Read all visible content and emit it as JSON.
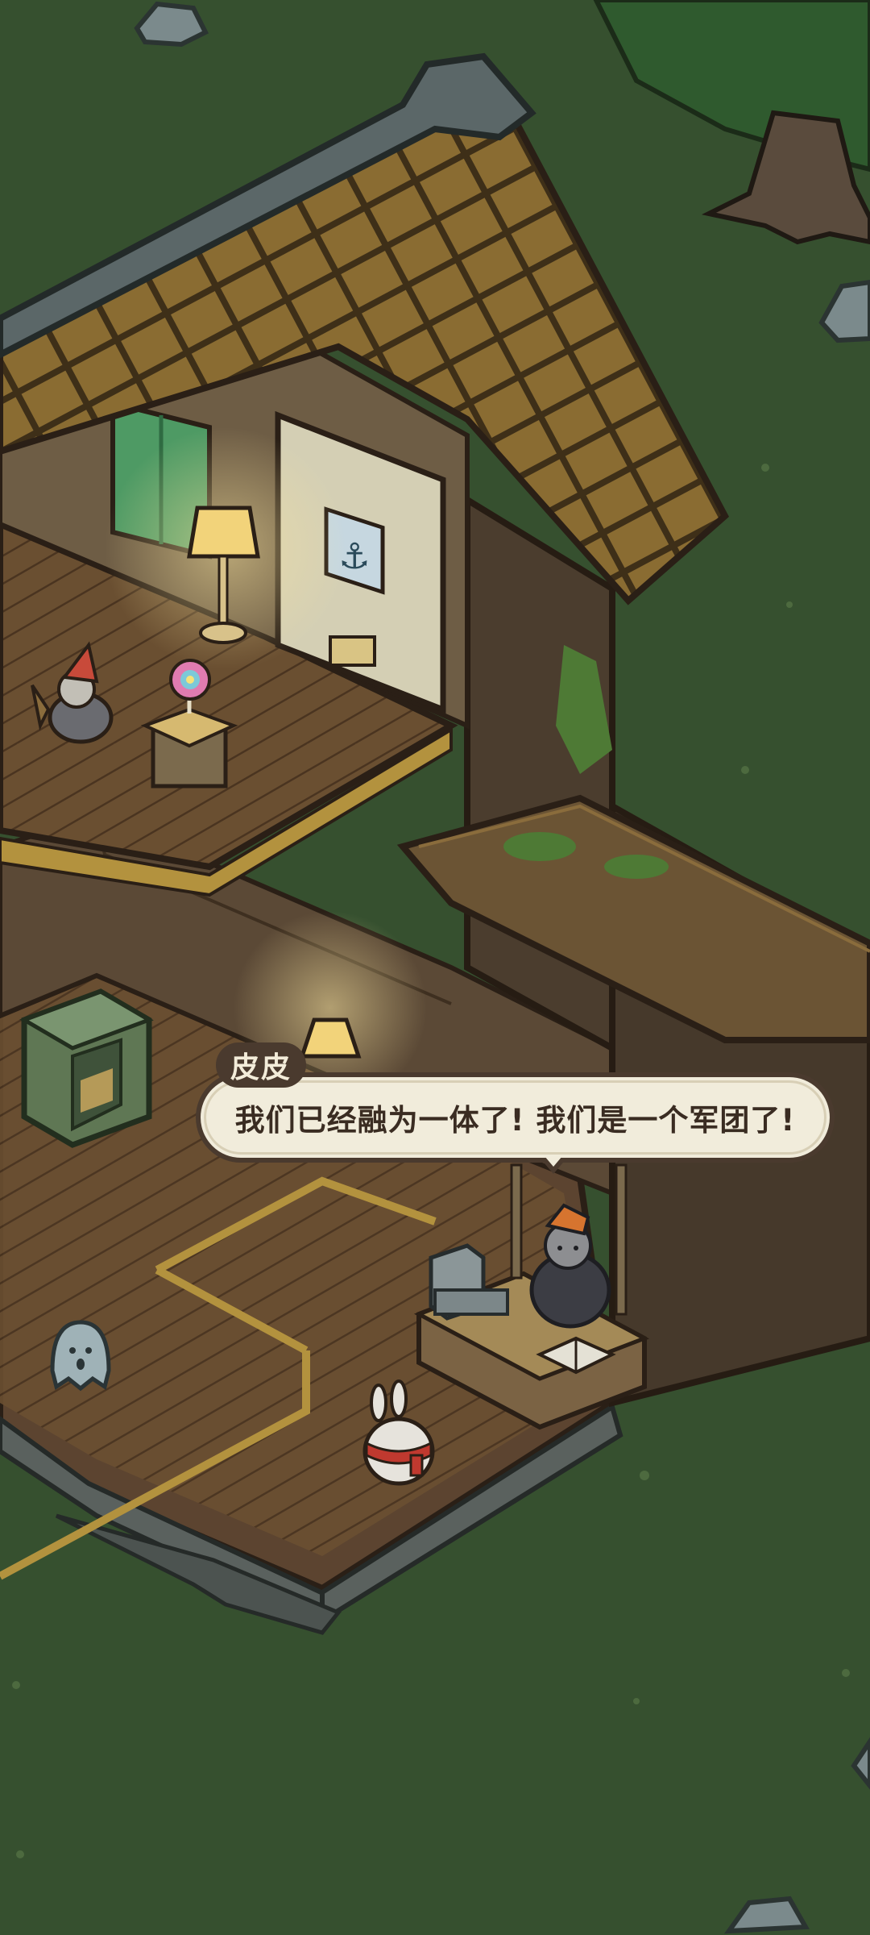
{
  "dialogue": {
    "speaker": "皮皮",
    "line": "我们已经融为一体了! 我们是一个军团了!"
  },
  "colors": {
    "grass": "#36502f",
    "floor": "#6e5233",
    "roof": "#7a5f2c",
    "bubble_fill": "#f1ecdb",
    "bubble_border": "#4a3a2e"
  }
}
